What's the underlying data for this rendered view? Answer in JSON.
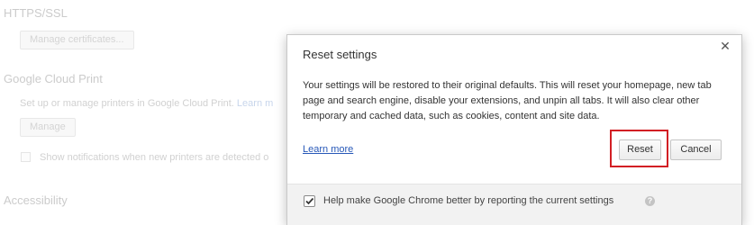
{
  "background": {
    "https_title": "HTTPS/SSL",
    "manage_certs_label": "Manage certificates...",
    "cloud_print_title": "Google Cloud Print",
    "cloud_print_desc": "Set up or manage printers in Google Cloud Print.",
    "learn_more_truncated": "Learn m",
    "manage_label": "Manage",
    "notify_label": "Show notifications when new printers are detected o",
    "accessibility_title": "Accessibility"
  },
  "dialog": {
    "title": "Reset settings",
    "close_icon": "close-icon",
    "body": "Your settings will be restored to their original defaults. This will reset your homepage, new tab page and search engine, disable your extensions, and unpin all tabs. It will also clear other temporary and cached data, such as cookies, content and site data.",
    "learn_more": "Learn more",
    "reset_label": "Reset",
    "cancel_label": "Cancel",
    "footer_checkbox_label": "Help make Google Chrome better by reporting the current settings",
    "footer_checked": true,
    "help_icon": "help-icon"
  },
  "colors": {
    "link": "#2758b8",
    "highlight": "#d21f24"
  }
}
